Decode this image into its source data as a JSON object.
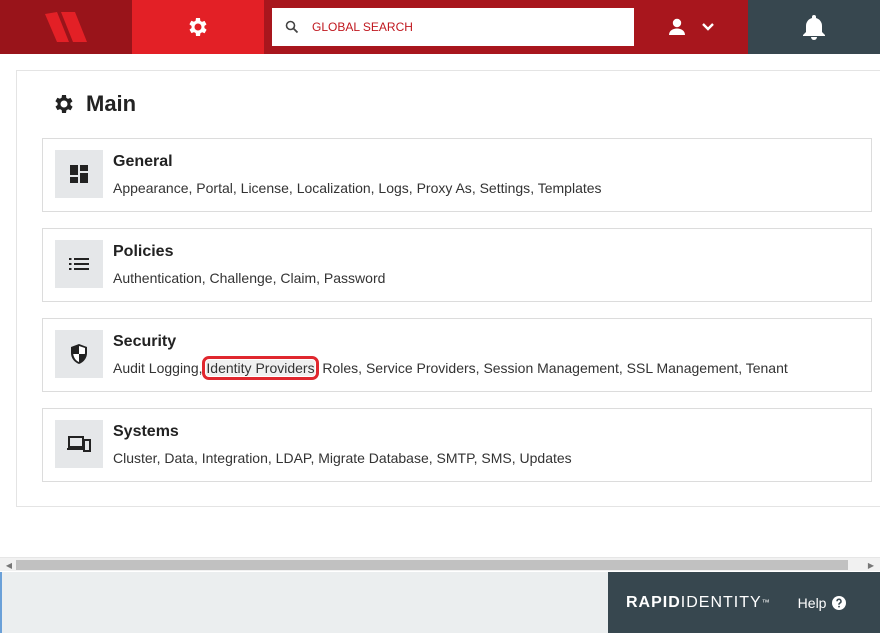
{
  "search": {
    "placeholder": "GLOBAL SEARCH"
  },
  "main": {
    "title": "Main",
    "cards": [
      {
        "title": "General",
        "links": [
          "Appearance",
          "Portal",
          "License",
          "Localization",
          "Logs",
          "Proxy As",
          "Settings",
          "Templates"
        ]
      },
      {
        "title": "Policies",
        "links": [
          "Authentication",
          "Challenge",
          "Claim",
          "Password"
        ]
      },
      {
        "title": "Security",
        "links": [
          "Audit Logging",
          "Identity Providers",
          "Roles",
          "Service Providers",
          "Session Management",
          "SSL Management",
          "Tenant"
        ],
        "highlighted": "Identity Providers"
      },
      {
        "title": "Systems",
        "links": [
          "Cluster",
          "Data",
          "Integration",
          "LDAP",
          "Migrate Database",
          "SMTP",
          "SMS",
          "Updates"
        ]
      }
    ]
  },
  "footer": {
    "brand_bold": "RAPID",
    "brand_light": "IDENTITY",
    "brand_tm": "™",
    "help_label": "Help"
  },
  "colors": {
    "topbar": "#a8161d",
    "accent": "#e32026",
    "dark": "#37474f"
  },
  "icons": {
    "logo": "rapididentity-logo",
    "settings": "gear-icon",
    "search": "search-icon",
    "user": "user-icon",
    "bell": "bell-icon"
  }
}
